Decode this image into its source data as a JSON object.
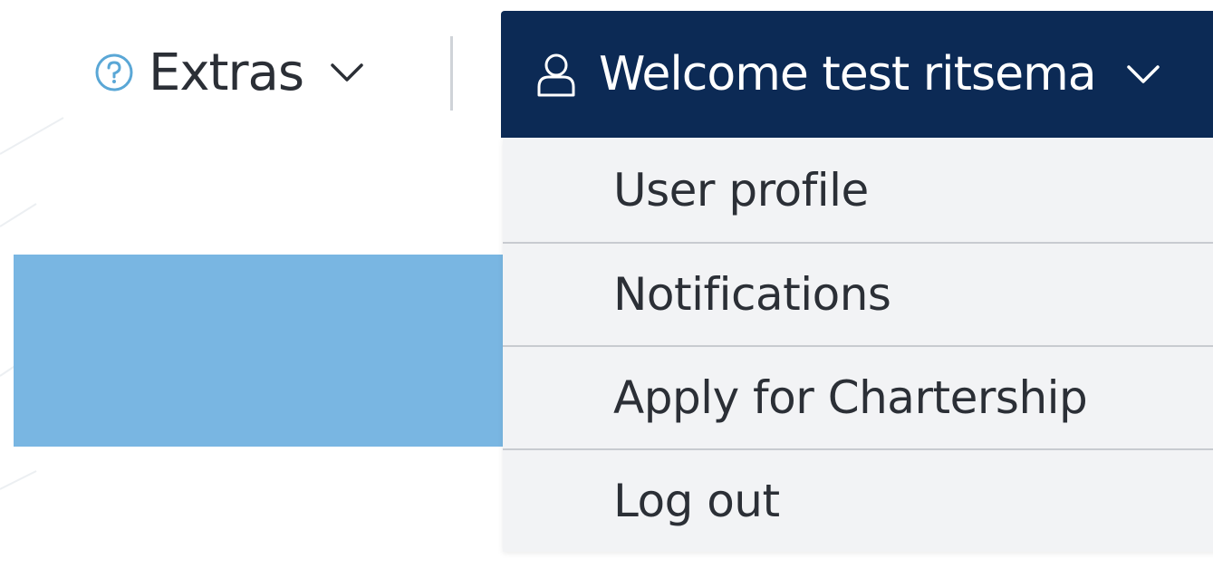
{
  "header": {
    "extras": {
      "label": "Extras",
      "icon": "help-circle-icon",
      "chevron_icon": "chevron-down-icon"
    },
    "user_menu": {
      "label": "Welcome test ritsema",
      "icon": "user-icon",
      "chevron_icon": "chevron-down-icon",
      "background_color": "#0c2a55",
      "expanded": true
    }
  },
  "dropdown": {
    "items": [
      {
        "label": "User profile"
      },
      {
        "label": "Notifications"
      },
      {
        "label": "Apply for Chartership"
      },
      {
        "label": "Log out"
      }
    ],
    "background_color": "#f2f3f5"
  },
  "colors": {
    "accent_blue_panel": "#79b6e2",
    "help_icon": "#5aa7d6"
  }
}
